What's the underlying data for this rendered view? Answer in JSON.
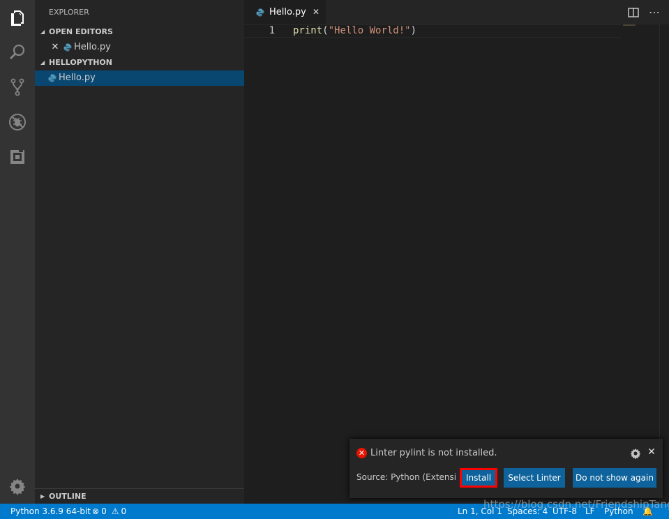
{
  "sidebar": {
    "title": "EXPLORER",
    "open_editors": {
      "header": "OPEN EDITORS",
      "items": [
        {
          "label": "Hello.py"
        }
      ]
    },
    "folder": {
      "header": "HELLOPYTHON",
      "items": [
        {
          "label": "Hello.py"
        }
      ]
    },
    "outline": {
      "header": "OUTLINE"
    }
  },
  "tab": {
    "label": "Hello.py"
  },
  "editor": {
    "line_number": "1",
    "code": {
      "fn": "print",
      "open": "(",
      "str": "\"Hello World!\"",
      "close": ")"
    }
  },
  "notification": {
    "message": "Linter pylint is not installed.",
    "source": "Source: Python (Extensi…",
    "buttons": {
      "install": "Install",
      "select": "Select Linter",
      "dont_show": "Do not show again"
    }
  },
  "statusbar": {
    "interpreter": "Python 3.6.9 64-bit",
    "errors": "0",
    "warnings": "0",
    "position": "Ln 1, Col 1",
    "spaces": "Spaces: 4",
    "encoding": "UTF-8",
    "eol": "LF",
    "language": "Python"
  },
  "watermark": "https://blog.csdn.net/FriendshipTang",
  "colors": {
    "accent": "#007acc",
    "selection": "#094771",
    "button": "#0e639c",
    "error": "#e51400",
    "highlight_border": "#ff0000"
  }
}
